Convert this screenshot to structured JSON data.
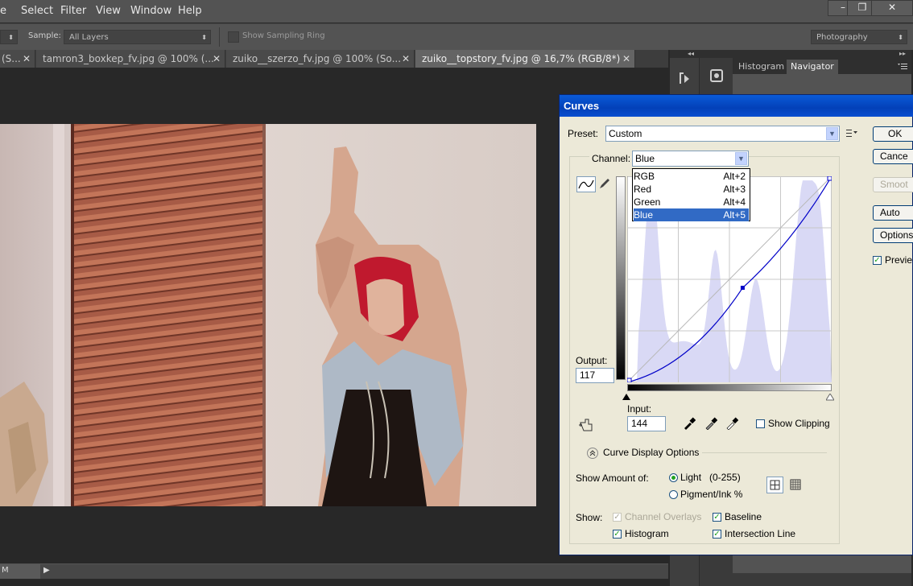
{
  "menubar": {
    "items": [
      "e",
      "Select",
      "Filter",
      "View",
      "Window",
      "Help"
    ],
    "window_controls": [
      "–",
      "❐",
      "✕"
    ]
  },
  "options_bar": {
    "sample_label": "Sample:",
    "sample_value": "All Layers",
    "show_sampling_ring": "Show Sampling Ring",
    "workspace": "Photography"
  },
  "tabs": [
    {
      "label": "(S...",
      "close": "✕"
    },
    {
      "label": "tamron3_boxkep_fv.jpg @ 100% (...",
      "close": "✕"
    },
    {
      "label": "zuiko__szerzo_fv.jpg @ 100% (So...",
      "close": "✕"
    },
    {
      "label": "zuiko__topstory_fv.jpg @ 16,7% (RGB/8*)",
      "close": "✕"
    }
  ],
  "panels": {
    "tabs": [
      "Histogram",
      "Navigator"
    ],
    "collapse": "◂◂",
    "expand": "▸▸"
  },
  "statusbar": {
    "zoom": "M",
    "arrow": "▶"
  },
  "curves": {
    "title": "Curves",
    "preset_label": "Preset:",
    "preset_value": "Custom",
    "channel_label": "Channel:",
    "channel_value": "Blue",
    "channel_options": [
      {
        "name": "RGB",
        "shortcut": "Alt+2"
      },
      {
        "name": "Red",
        "shortcut": "Alt+3"
      },
      {
        "name": "Green",
        "shortcut": "Alt+4"
      },
      {
        "name": "Blue",
        "shortcut": "Alt+5"
      }
    ],
    "output_label": "Output:",
    "output_value": "117",
    "input_label": "Input:",
    "input_value": "144",
    "show_clipping": "Show Clipping",
    "curve_display_options": "Curve Display Options",
    "show_amount_label": "Show Amount of:",
    "light_label": "Light",
    "light_range": "(0-255)",
    "pigment_label": "Pigment/Ink %",
    "show_label": "Show:",
    "channel_overlays": "Channel Overlays",
    "baseline": "Baseline",
    "histogram": "Histogram",
    "intersection_line": "Intersection Line",
    "buttons": {
      "ok": "OK",
      "cancel": "Cance",
      "smooth": "Smoot",
      "auto": "Auto",
      "options": "Options"
    },
    "preview": "Previe",
    "point": {
      "input": 144,
      "output": 117
    },
    "colors": {
      "histogram": "#d9d9f5",
      "curve": "#0000c8",
      "title": "#0a4fd0"
    }
  }
}
